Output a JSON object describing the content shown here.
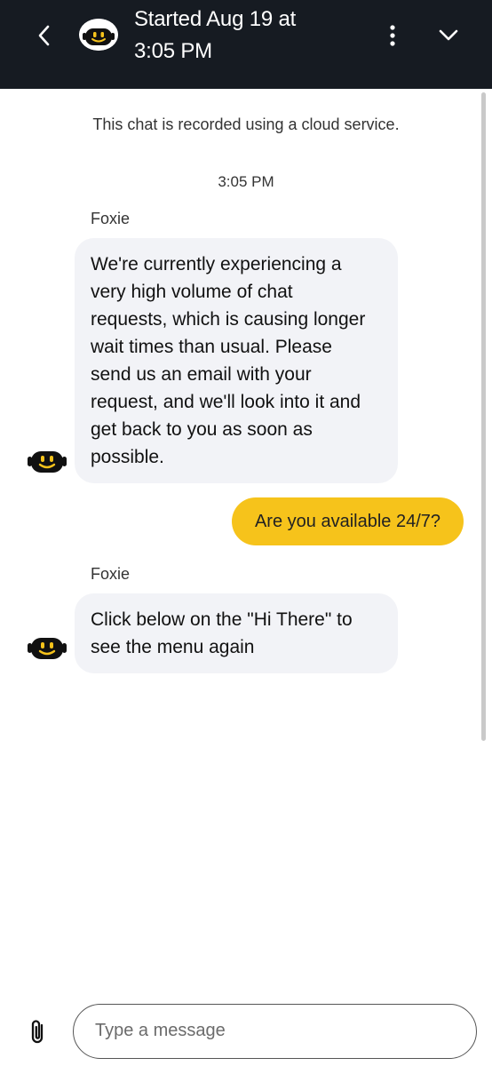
{
  "header": {
    "title_line1": "Started Aug 19 at",
    "title_line2": "3:05 PM",
    "icons": {
      "back": "back-chevron-icon",
      "avatar": "robot-avatar-icon",
      "menu": "more-vertical-icon",
      "collapse": "chevron-down-icon"
    },
    "background_color": "#161b22"
  },
  "chat": {
    "notice": "This chat is recorded using a cloud service.",
    "timestamp": "3:05 PM",
    "messages": [
      {
        "from": "bot",
        "sender": "Foxie",
        "lines": [
          "We're currently experiencing a",
          "very high volume of chat",
          "requests, which is causing longer",
          "wait times than usual. Please",
          "send us an email with your",
          "request, and we'll look into it and",
          "get back to you as soon as",
          "possible."
        ]
      },
      {
        "from": "user",
        "text": "Are you available 24/7?"
      },
      {
        "from": "bot",
        "sender": "Foxie",
        "lines": [
          "Click below on the \"Hi There\" to",
          "see the menu again"
        ]
      }
    ],
    "colors": {
      "bot_bubble": "#f2f3f7",
      "user_bubble": "#f6c31b"
    }
  },
  "composer": {
    "placeholder": "Type a message",
    "value": "",
    "attach_icon": "paperclip-icon"
  }
}
